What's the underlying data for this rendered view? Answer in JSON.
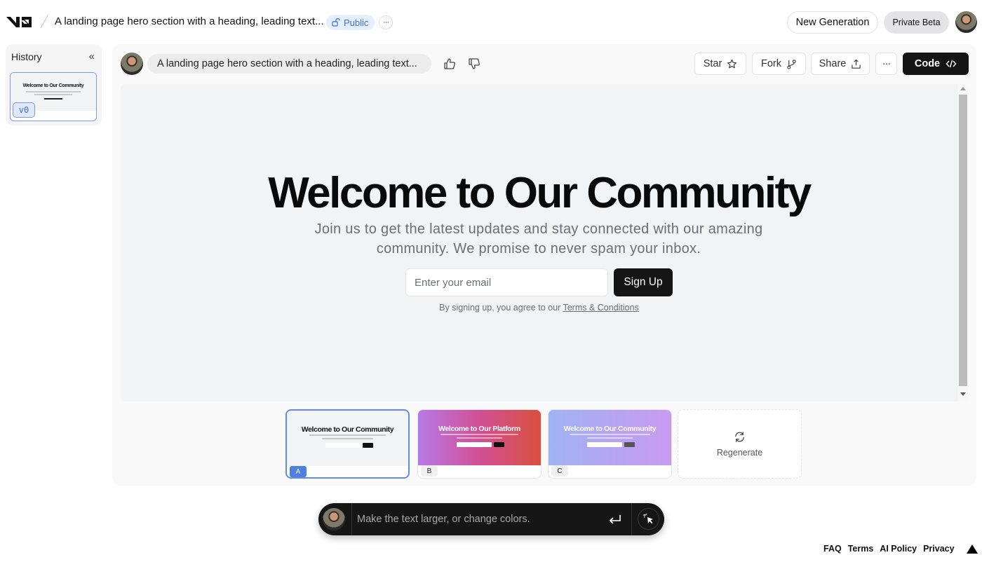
{
  "header": {
    "logo": "v0",
    "title": "A landing page hero section with a heading, leading text...",
    "visibility_badge": "Public",
    "visibility_icon": "unlock-icon",
    "more_label": "···",
    "new_generation_label": "New Generation",
    "private_beta_label": "Private Beta"
  },
  "history": {
    "label": "History",
    "collapse_icon": "«",
    "items": [
      {
        "version": "v0",
        "thumb_heading": "Welcome to Our Community",
        "selected": true
      }
    ]
  },
  "toolbar": {
    "prompt": "A landing page hero section with a heading, leading text...",
    "thumbs_up": "thumbs-up-icon",
    "thumbs_down": "thumbs-down-icon",
    "star_label": "Star",
    "fork_label": "Fork",
    "share_label": "Share",
    "more_label": "···",
    "code_label": "Code"
  },
  "preview": {
    "heading": "Welcome to Our Community",
    "subtext": "Join us to get the latest updates and stay connected with our amazing community. We promise to never spam your inbox.",
    "email_placeholder": "Enter your email",
    "signup_label": "Sign Up",
    "agree_text": "By signing up, you agree to our ",
    "agree_link": "Terms & Conditions"
  },
  "variants": [
    {
      "label": "A",
      "heading": "Welcome to Our Community",
      "selected": true,
      "style": "light"
    },
    {
      "label": "B",
      "heading": "Welcome to Our Platform",
      "selected": false,
      "style": "purple-red-gradient"
    },
    {
      "label": "C",
      "heading": "Welcome to Our Community",
      "selected": false,
      "style": "blue-purple-gradient"
    }
  ],
  "regenerate_label": "Regenerate",
  "chat": {
    "placeholder": "Make the text larger, or change colors."
  },
  "footer": {
    "links": [
      "FAQ",
      "Terms",
      "AI Policy",
      "Privacy"
    ]
  },
  "colors": {
    "accent_blue": "#3a6fd8",
    "selected_border": "#6489e6",
    "dark_button": "#151515",
    "preview_bg": "#f2f3f5"
  }
}
